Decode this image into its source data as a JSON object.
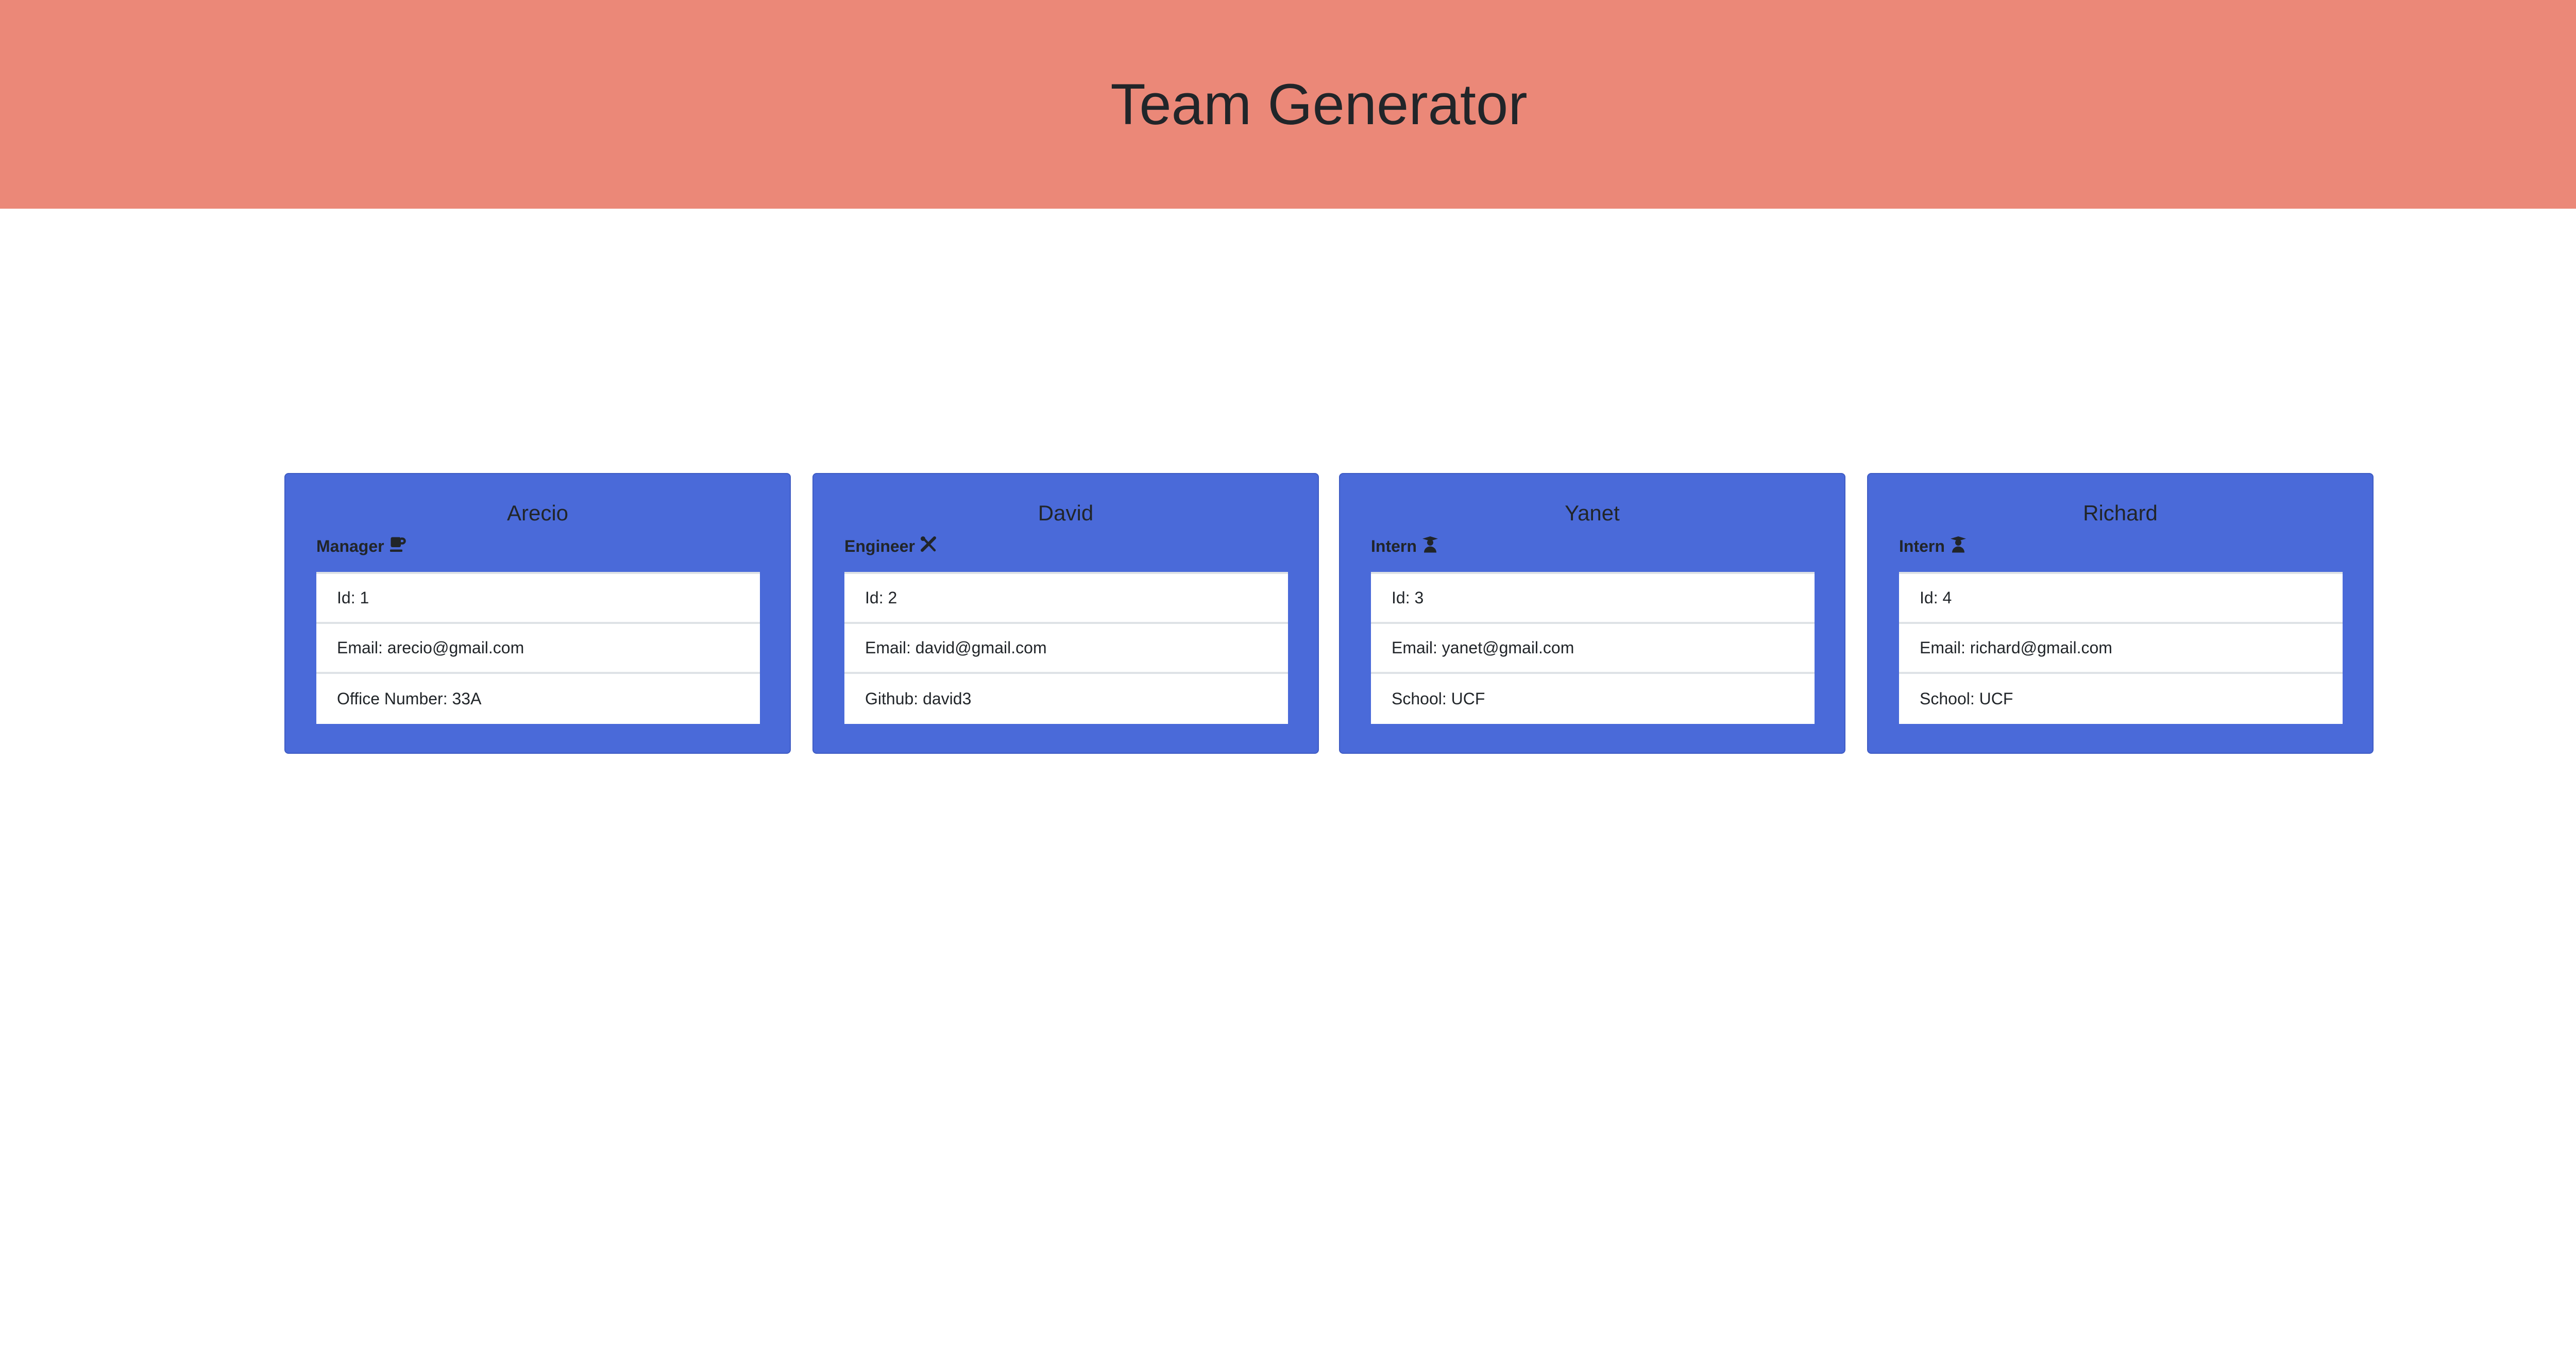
{
  "header": {
    "title": "Team Generator"
  },
  "colors": {
    "header": "#eb8878",
    "card": "#4a6ad9"
  },
  "cards": [
    {
      "name": "Arecio",
      "role": "Manager",
      "icon": "mug-icon",
      "rows": [
        "Id: 1",
        "Email: arecio@gmail.com",
        "Office Number: 33A"
      ]
    },
    {
      "name": "David",
      "role": "Engineer",
      "icon": "tools-icon",
      "rows": [
        "Id: 2",
        "Email: david@gmail.com",
        "Github: david3"
      ]
    },
    {
      "name": "Yanet",
      "role": "Intern",
      "icon": "graduate-icon",
      "rows": [
        "Id: 3",
        "Email: yanet@gmail.com",
        "School: UCF"
      ]
    },
    {
      "name": "Richard",
      "role": "Intern",
      "icon": "graduate-icon",
      "rows": [
        "Id: 4",
        "Email: richard@gmail.com",
        "School: UCF"
      ]
    }
  ]
}
